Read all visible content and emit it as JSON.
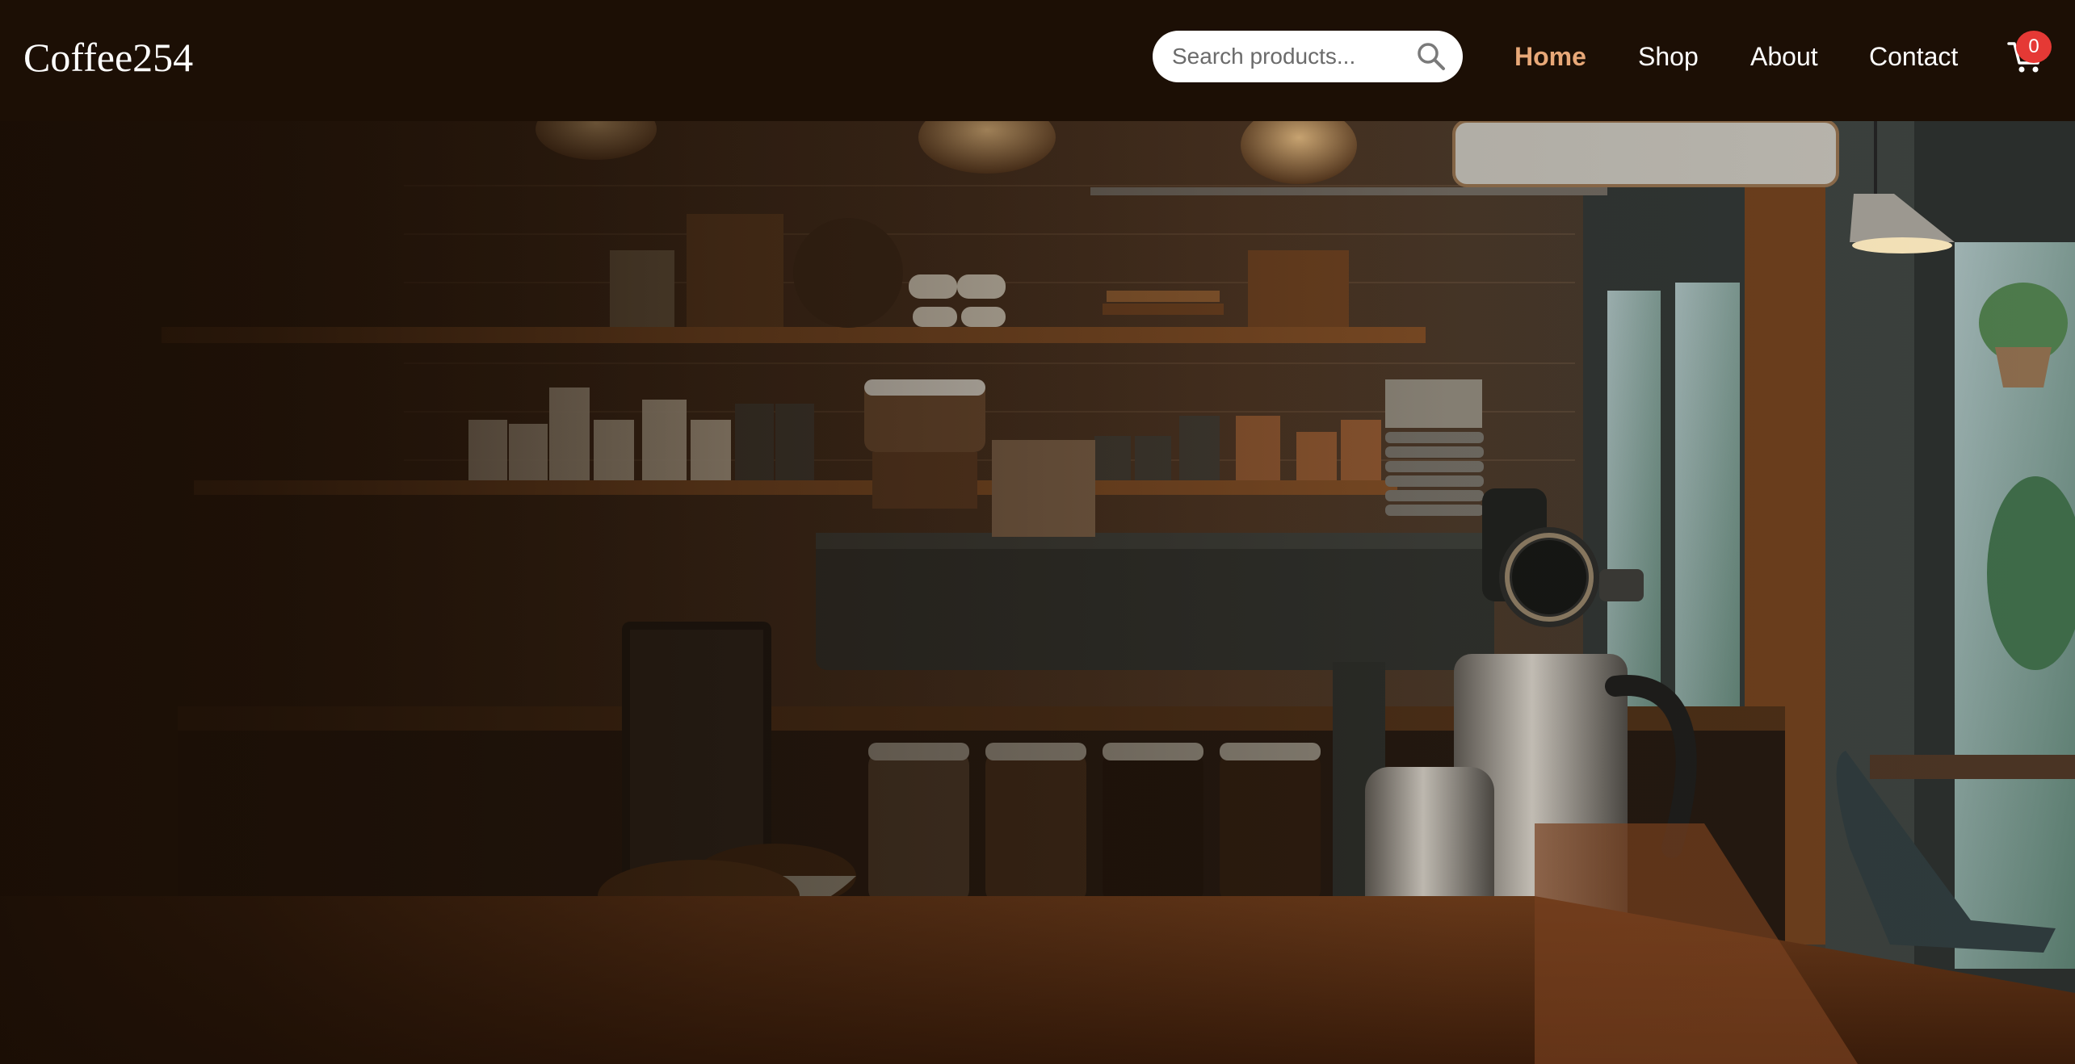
{
  "brand": {
    "name": "Coffee254"
  },
  "search": {
    "placeholder": "Search products...",
    "value": ""
  },
  "nav": {
    "items": [
      {
        "label": "Home",
        "active": true
      },
      {
        "label": "Shop",
        "active": false
      },
      {
        "label": "About",
        "active": false
      },
      {
        "label": "Contact",
        "active": false
      }
    ]
  },
  "cart": {
    "count": "0"
  },
  "icons": {
    "search": "search-icon",
    "cart": "cart-icon"
  },
  "colors": {
    "navbar_bg": "#1c0f05",
    "active_link": "#e8a878",
    "cart_badge": "#e53935"
  },
  "hero": {
    "image_alt": "coffee-shop-espresso-machine-hero-image"
  }
}
